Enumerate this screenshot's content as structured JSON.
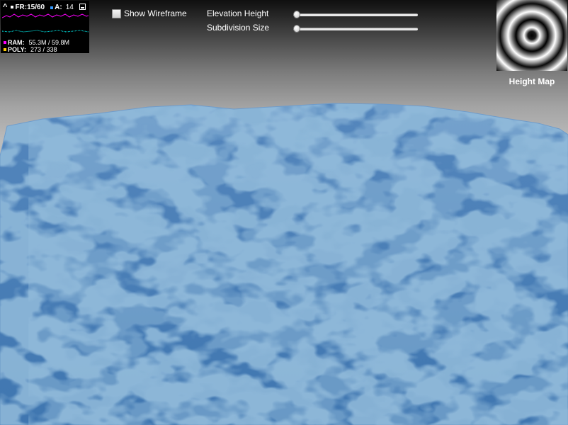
{
  "stats": {
    "fr_label": "FR:15/60",
    "a_label": "A:",
    "a_value": "14",
    "ram_label": "RAM:",
    "ram_value": "55.3M / 59.8M",
    "poly_label": "POLY:",
    "poly_value": "273 / 338"
  },
  "controls": {
    "wireframe_label": "Show Wireframe",
    "wireframe_checked": false,
    "elevation_label": "Elevation Height",
    "elevation_level": 0.0,
    "subdivision_label": "Subdivision Size",
    "subdivision_level": 0.0
  },
  "heightmap": {
    "label": "Height Map"
  },
  "colors": {
    "water_base": "#4a7fb5",
    "water_highlight": "#dfeefa",
    "fr_graph": "#ff00ff",
    "ms_graph": "#00ffff",
    "ram_marker": "#ff00ff",
    "poly_marker": "#ffcc00",
    "a_marker": "#3399ff"
  },
  "icons": {
    "collapse": "caret-up-icon",
    "minimize": "minimize-icon"
  }
}
